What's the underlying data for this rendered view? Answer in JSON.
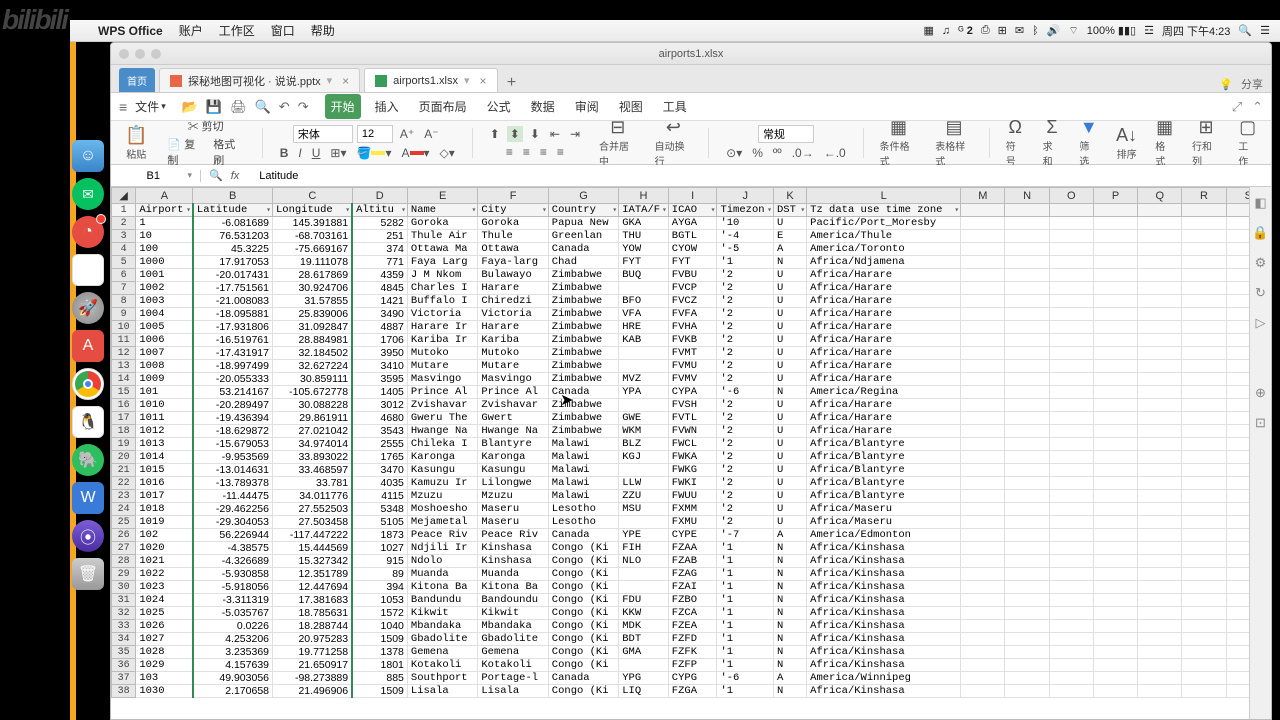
{
  "watermark": "bilibili",
  "menubar": {
    "app": "WPS Office",
    "items": [
      "账户",
      "工作区",
      "窗口",
      "帮助"
    ],
    "right": {
      "battery": "100%",
      "clock": "周四 下午4:23",
      "g2": "2"
    }
  },
  "window": {
    "title": "airports1.xlsx"
  },
  "tabs": {
    "home": "首页",
    "items": [
      {
        "label": "探秘地图可视化 · 说说.pptx",
        "type": "ppt"
      },
      {
        "label": "airports1.xlsx",
        "type": "xls",
        "active": true
      }
    ],
    "share": "分享"
  },
  "ribbon_menus": [
    "文件"
  ],
  "ribbon_tabs": [
    "开始",
    "插入",
    "页面布局",
    "公式",
    "数据",
    "审阅",
    "视图",
    "工具"
  ],
  "toolbar": {
    "paste": "粘贴",
    "cut": "剪切",
    "copy": "复制",
    "brush": "格式刷",
    "font": "宋体",
    "size": "12",
    "merge": "合并居中",
    "wrap": "自动换行",
    "numfmt": "常规",
    "condfmt": "条件格式",
    "tblstyle": "表格样式",
    "symbol": "符号",
    "sum": "求和",
    "filter": "筛选",
    "sort": "排序",
    "format": "格式",
    "rowcol": "行和列",
    "sheet": "工作"
  },
  "formula": {
    "cell": "B1",
    "value": "Latitude"
  },
  "columns": [
    "A",
    "B",
    "C",
    "D",
    "E",
    "F",
    "G",
    "H",
    "I",
    "J",
    "K",
    "L",
    "M",
    "N",
    "O",
    "P",
    "Q",
    "R",
    "S"
  ],
  "headers": {
    "A": "Airport",
    "B": "Latitude",
    "C": "Longitude",
    "D": "Altitu",
    "E": "Name",
    "F": "City",
    "G": "Country",
    "H": "IATA/F",
    "I": "ICAO",
    "J": "Timezon",
    "K": "DST",
    "L": "Tz data use time zone"
  },
  "rows": [
    {
      "r": 2,
      "A": "1",
      "B": "-6.081689",
      "C": "145.391881",
      "D": "5282",
      "E": "Goroka",
      "F": "Goroka",
      "G": "Papua New",
      "H": "GKA",
      "I": "AYGA",
      "J": "'10",
      "K": "U",
      "L": "Pacific/Port_Moresby"
    },
    {
      "r": 3,
      "A": "10",
      "B": "76.531203",
      "C": "-68.703161",
      "D": "251",
      "E": "Thule Air",
      "F": "Thule",
      "G": "Greenlan",
      "H": "THU",
      "I": "BGTL",
      "J": "'-4",
      "K": "E",
      "L": "America/Thule"
    },
    {
      "r": 4,
      "A": "100",
      "B": "45.3225",
      "C": "-75.669167",
      "D": "374",
      "E": "Ottawa Ma",
      "F": "Ottawa",
      "G": "Canada",
      "H": "YOW",
      "I": "CYOW",
      "J": "'-5",
      "K": "A",
      "L": "America/Toronto"
    },
    {
      "r": 5,
      "A": "1000",
      "B": "17.917053",
      "C": "19.111078",
      "D": "771",
      "E": "Faya Larg",
      "F": "Faya-larg",
      "G": "Chad",
      "H": "FYT",
      "I": "FYT",
      "J": "'1",
      "K": "N",
      "L": "Africa/Ndjamena"
    },
    {
      "r": 6,
      "A": "1001",
      "B": "-20.017431",
      "C": "28.617869",
      "D": "4359",
      "E": "J M Nkom",
      "F": "Bulawayo",
      "G": "Zimbabwe",
      "H": "BUQ",
      "I": "FVBU",
      "J": "'2",
      "K": "U",
      "L": "Africa/Harare"
    },
    {
      "r": 7,
      "A": "1002",
      "B": "-17.751561",
      "C": "30.924706",
      "D": "4845",
      "E": "Charles I",
      "F": "Harare",
      "G": "Zimbabwe",
      "H": "",
      "I": "FVCP",
      "J": "'2",
      "K": "U",
      "L": "Africa/Harare"
    },
    {
      "r": 8,
      "A": "1003",
      "B": "-21.008083",
      "C": "31.57855",
      "D": "1421",
      "E": "Buffalo I",
      "F": "Chiredzi",
      "G": "Zimbabwe",
      "H": "BFO",
      "I": "FVCZ",
      "J": "'2",
      "K": "U",
      "L": "Africa/Harare"
    },
    {
      "r": 9,
      "A": "1004",
      "B": "-18.095881",
      "C": "25.839006",
      "D": "3490",
      "E": "Victoria",
      "F": "Victoria",
      "G": "Zimbabwe",
      "H": "VFA",
      "I": "FVFA",
      "J": "'2",
      "K": "U",
      "L": "Africa/Harare"
    },
    {
      "r": 10,
      "A": "1005",
      "B": "-17.931806",
      "C": "31.092847",
      "D": "4887",
      "E": "Harare Ir",
      "F": "Harare",
      "G": "Zimbabwe",
      "H": "HRE",
      "I": "FVHA",
      "J": "'2",
      "K": "U",
      "L": "Africa/Harare"
    },
    {
      "r": 11,
      "A": "1006",
      "B": "-16.519761",
      "C": "28.884981",
      "D": "1706",
      "E": "Kariba Ir",
      "F": "Kariba",
      "G": "Zimbabwe",
      "H": "KAB",
      "I": "FVKB",
      "J": "'2",
      "K": "U",
      "L": "Africa/Harare"
    },
    {
      "r": 12,
      "A": "1007",
      "B": "-17.431917",
      "C": "32.184502",
      "D": "3950",
      "E": "Mutoko",
      "F": "Mutoko",
      "G": "Zimbabwe",
      "H": "",
      "I": "FVMT",
      "J": "'2",
      "K": "U",
      "L": "Africa/Harare"
    },
    {
      "r": 13,
      "A": "1008",
      "B": "-18.997499",
      "C": "32.627224",
      "D": "3410",
      "E": "Mutare",
      "F": "Mutare",
      "G": "Zimbabwe",
      "H": "",
      "I": "FVMU",
      "J": "'2",
      "K": "U",
      "L": "Africa/Harare"
    },
    {
      "r": 14,
      "A": "1009",
      "B": "-20.055333",
      "C": "30.859111",
      "D": "3595",
      "E": "Masvingo",
      "F": "Masvingo",
      "G": "Zimbabwe",
      "H": "MVZ",
      "I": "FVMV",
      "J": "'2",
      "K": "U",
      "L": "Africa/Harare"
    },
    {
      "r": 15,
      "A": "101",
      "B": "53.214167",
      "C": "-105.672778",
      "D": "1405",
      "E": "Prince Al",
      "F": "Prince Al",
      "G": "Canada",
      "H": "YPA",
      "I": "CYPA",
      "J": "'-6",
      "K": "N",
      "L": "America/Regina"
    },
    {
      "r": 16,
      "A": "1010",
      "B": "-20.289497",
      "C": "30.088228",
      "D": "3012",
      "E": "Zvishavar",
      "F": "Zvishavar",
      "G": "Zimbabwe",
      "H": "",
      "I": "FVSH",
      "J": "'2",
      "K": "U",
      "L": "Africa/Harare"
    },
    {
      "r": 17,
      "A": "1011",
      "B": "-19.436394",
      "C": "29.861911",
      "D": "4680",
      "E": "Gweru The",
      "F": "Gwert",
      "G": "Zimbabwe",
      "H": "GWE",
      "I": "FVTL",
      "J": "'2",
      "K": "U",
      "L": "Africa/Harare"
    },
    {
      "r": 18,
      "A": "1012",
      "B": "-18.629872",
      "C": "27.021042",
      "D": "3543",
      "E": "Hwange Na",
      "F": "Hwange Na",
      "G": "Zimbabwe",
      "H": "WKM",
      "I": "FVWN",
      "J": "'2",
      "K": "U",
      "L": "Africa/Harare"
    },
    {
      "r": 19,
      "A": "1013",
      "B": "-15.679053",
      "C": "34.974014",
      "D": "2555",
      "E": "Chileka I",
      "F": "Blantyre",
      "G": "Malawi",
      "H": "BLZ",
      "I": "FWCL",
      "J": "'2",
      "K": "U",
      "L": "Africa/Blantyre"
    },
    {
      "r": 20,
      "A": "1014",
      "B": "-9.953569",
      "C": "33.893022",
      "D": "1765",
      "E": "Karonga",
      "F": "Karonga",
      "G": "Malawi",
      "H": "KGJ",
      "I": "FWKA",
      "J": "'2",
      "K": "U",
      "L": "Africa/Blantyre"
    },
    {
      "r": 21,
      "A": "1015",
      "B": "-13.014631",
      "C": "33.468597",
      "D": "3470",
      "E": "Kasungu",
      "F": "Kasungu",
      "G": "Malawi",
      "H": "",
      "I": "FWKG",
      "J": "'2",
      "K": "U",
      "L": "Africa/Blantyre"
    },
    {
      "r": 22,
      "A": "1016",
      "B": "-13.789378",
      "C": "33.781",
      "D": "4035",
      "E": "Kamuzu Ir",
      "F": "Lilongwe",
      "G": "Malawi",
      "H": "LLW",
      "I": "FWKI",
      "J": "'2",
      "K": "U",
      "L": "Africa/Blantyre"
    },
    {
      "r": 23,
      "A": "1017",
      "B": "-11.44475",
      "C": "34.011776",
      "D": "4115",
      "E": "Mzuzu",
      "F": "Mzuzu",
      "G": "Malawi",
      "H": "ZZU",
      "I": "FWUU",
      "J": "'2",
      "K": "U",
      "L": "Africa/Blantyre"
    },
    {
      "r": 24,
      "A": "1018",
      "B": "-29.462256",
      "C": "27.552503",
      "D": "5348",
      "E": "Moshoesho",
      "F": "Maseru",
      "G": "Lesotho",
      "H": "MSU",
      "I": "FXMM",
      "J": "'2",
      "K": "U",
      "L": "Africa/Maseru"
    },
    {
      "r": 25,
      "A": "1019",
      "B": "-29.304053",
      "C": "27.503458",
      "D": "5105",
      "E": "Mejametal",
      "F": "Maseru",
      "G": "Lesotho",
      "H": "",
      "I": "FXMU",
      "J": "'2",
      "K": "U",
      "L": "Africa/Maseru"
    },
    {
      "r": 26,
      "A": "102",
      "B": "56.226944",
      "C": "-117.447222",
      "D": "1873",
      "E": "Peace Riv",
      "F": "Peace Riv",
      "G": "Canada",
      "H": "YPE",
      "I": "CYPE",
      "J": "'-7",
      "K": "A",
      "L": "America/Edmonton"
    },
    {
      "r": 27,
      "A": "1020",
      "B": "-4.38575",
      "C": "15.444569",
      "D": "1027",
      "E": "Ndjili Ir",
      "F": "Kinshasa",
      "G": "Congo (Ki",
      "H": "FIH",
      "I": "FZAA",
      "J": "'1",
      "K": "N",
      "L": "Africa/Kinshasa"
    },
    {
      "r": 28,
      "A": "1021",
      "B": "-4.326689",
      "C": "15.327342",
      "D": "915",
      "E": "Ndolo",
      "F": "Kinshasa",
      "G": "Congo (Ki",
      "H": "NLO",
      "I": "FZAB",
      "J": "'1",
      "K": "N",
      "L": "Africa/Kinshasa"
    },
    {
      "r": 29,
      "A": "1022",
      "B": "-5.930858",
      "C": "12.351789",
      "D": "89",
      "E": "Muanda",
      "F": "Muanda",
      "G": "Congo (Ki",
      "H": "",
      "I": "FZAG",
      "J": "'1",
      "K": "N",
      "L": "Africa/Kinshasa"
    },
    {
      "r": 30,
      "A": "1023",
      "B": "-5.918056",
      "C": "12.447694",
      "D": "394",
      "E": "Kitona Ba",
      "F": "Kitona Ba",
      "G": "Congo (Ki",
      "H": "",
      "I": "FZAI",
      "J": "'1",
      "K": "N",
      "L": "Africa/Kinshasa"
    },
    {
      "r": 31,
      "A": "1024",
      "B": "-3.311319",
      "C": "17.381683",
      "D": "1053",
      "E": "Bandundu",
      "F": "Bandoundu",
      "G": "Congo (Ki",
      "H": "FDU",
      "I": "FZBO",
      "J": "'1",
      "K": "N",
      "L": "Africa/Kinshasa"
    },
    {
      "r": 32,
      "A": "1025",
      "B": "-5.035767",
      "C": "18.785631",
      "D": "1572",
      "E": "Kikwit",
      "F": "Kikwit",
      "G": "Congo (Ki",
      "H": "KKW",
      "I": "FZCA",
      "J": "'1",
      "K": "N",
      "L": "Africa/Kinshasa"
    },
    {
      "r": 33,
      "A": "1026",
      "B": "0.0226",
      "C": "18.288744",
      "D": "1040",
      "E": "Mbandaka",
      "F": "Mbandaka",
      "G": "Congo (Ki",
      "H": "MDK",
      "I": "FZEA",
      "J": "'1",
      "K": "N",
      "L": "Africa/Kinshasa"
    },
    {
      "r": 34,
      "A": "1027",
      "B": "4.253206",
      "C": "20.975283",
      "D": "1509",
      "E": "Gbadolite",
      "F": "Gbadolite",
      "G": "Congo (Ki",
      "H": "BDT",
      "I": "FZFD",
      "J": "'1",
      "K": "N",
      "L": "Africa/Kinshasa"
    },
    {
      "r": 35,
      "A": "1028",
      "B": "3.235369",
      "C": "19.771258",
      "D": "1378",
      "E": "Gemena",
      "F": "Gemena",
      "G": "Congo (Ki",
      "H": "GMA",
      "I": "FZFK",
      "J": "'1",
      "K": "N",
      "L": "Africa/Kinshasa"
    },
    {
      "r": 36,
      "A": "1029",
      "B": "4.157639",
      "C": "21.650917",
      "D": "1801",
      "E": "Kotakoli",
      "F": "Kotakoli",
      "G": "Congo (Ki",
      "H": "",
      "I": "FZFP",
      "J": "'1",
      "K": "N",
      "L": "Africa/Kinshasa"
    },
    {
      "r": 37,
      "A": "103",
      "B": "49.903056",
      "C": "-98.273889",
      "D": "885",
      "E": "Southport",
      "F": "Portage-l",
      "G": "Canada",
      "H": "YPG",
      "I": "CYPG",
      "J": "'-6",
      "K": "A",
      "L": "America/Winnipeg"
    },
    {
      "r": 38,
      "A": "1030",
      "B": "2.170658",
      "C": "21.496906",
      "D": "1509",
      "E": "Lisala",
      "F": "Lisala",
      "G": "Congo (Ki",
      "H": "LIQ",
      "I": "FZGA",
      "J": "'1",
      "K": "N",
      "L": "Africa/Kinshasa"
    }
  ]
}
